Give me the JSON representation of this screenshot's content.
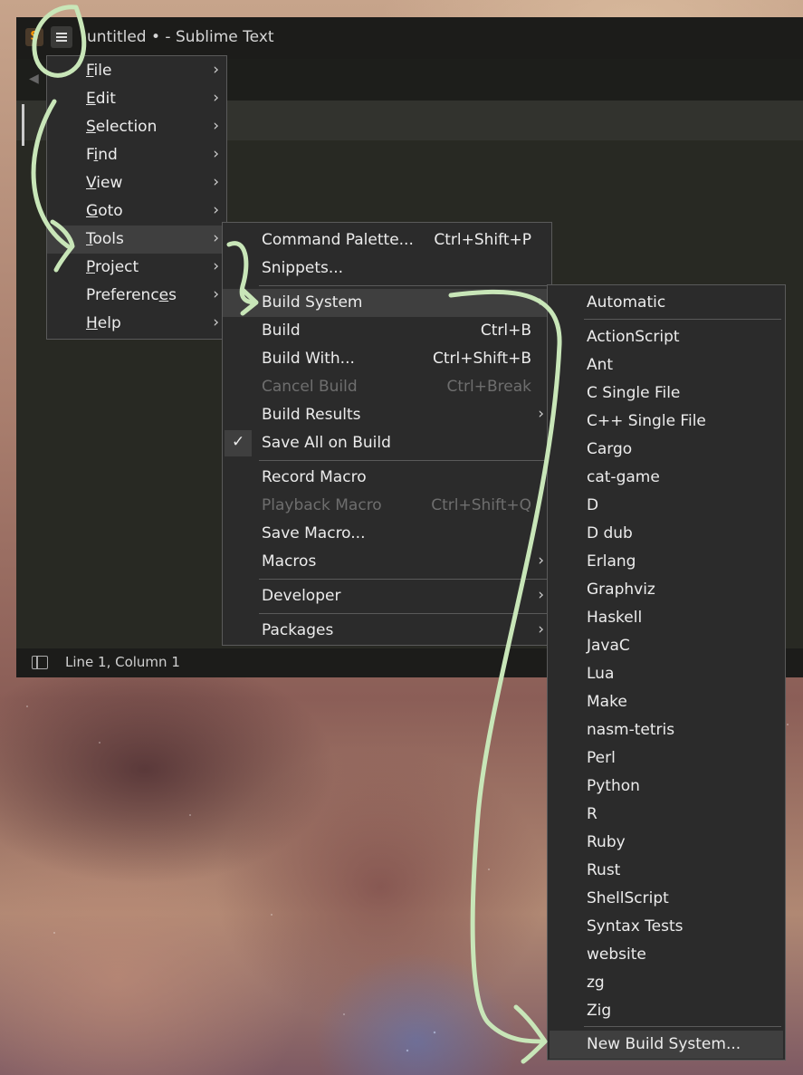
{
  "window": {
    "title": "untitled • - Sublime Text",
    "logo": "S"
  },
  "status": {
    "position": "Line 1, Column 1"
  },
  "main_menu": [
    {
      "label": "File",
      "mnemonic": 0
    },
    {
      "label": "Edit",
      "mnemonic": 0
    },
    {
      "label": "Selection",
      "mnemonic": 0
    },
    {
      "label": "Find",
      "mnemonic": 1
    },
    {
      "label": "View",
      "mnemonic": 0
    },
    {
      "label": "Goto",
      "mnemonic": 0
    },
    {
      "label": "Tools",
      "mnemonic": 0,
      "highlighted": true
    },
    {
      "label": "Project",
      "mnemonic": 0
    },
    {
      "label": "Preferences",
      "mnemonic": 9
    },
    {
      "label": "Help",
      "mnemonic": 0
    }
  ],
  "tools_menu": {
    "command_palette": {
      "label": "Command Palette...",
      "shortcut": "Ctrl+Shift+P"
    },
    "snippets": {
      "label": "Snippets..."
    },
    "build_system": {
      "label": "Build System"
    },
    "build": {
      "label": "Build",
      "shortcut": "Ctrl+B"
    },
    "build_with": {
      "label": "Build With...",
      "shortcut": "Ctrl+Shift+B"
    },
    "cancel_build": {
      "label": "Cancel Build",
      "shortcut": "Ctrl+Break"
    },
    "build_results": {
      "label": "Build Results"
    },
    "save_all_on_build": {
      "label": "Save All on Build",
      "check": "✓"
    },
    "record_macro": {
      "label": "Record Macro"
    },
    "playback_macro": {
      "label": "Playback Macro",
      "shortcut": "Ctrl+Shift+Q"
    },
    "save_macro": {
      "label": "Save Macro..."
    },
    "macros": {
      "label": "Macros"
    },
    "developer": {
      "label": "Developer"
    },
    "packages": {
      "label": "Packages"
    }
  },
  "build_system_menu": {
    "automatic": "Automatic",
    "systems": [
      "ActionScript",
      "Ant",
      "C Single File",
      "C++ Single File",
      "Cargo",
      "cat-game",
      "D",
      "D dub",
      "Erlang",
      "Graphviz",
      "Haskell",
      "JavaC",
      "Lua",
      "Make",
      "nasm-tetris",
      "Perl",
      "Python",
      "R",
      "Ruby",
      "Rust",
      "ShellScript",
      "Syntax Tests",
      "website",
      "zg",
      "Zig"
    ],
    "new_build_system": "New Build System..."
  },
  "annotation_color": "#c8e6b8"
}
